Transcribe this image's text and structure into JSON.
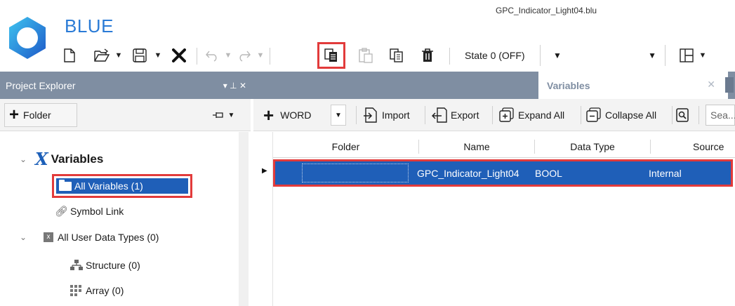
{
  "app": {
    "name": "BLUE",
    "file_title": "GPC_Indicator_Light04.blu"
  },
  "toolbar": {
    "icons": [
      "new-file-icon",
      "open-icon",
      "save-icon",
      "delete-x-icon",
      "undo-icon",
      "redo-icon",
      "copy-icon",
      "paste-icon",
      "duplicate-icon",
      "trash-icon",
      "layout-icon"
    ],
    "state_value": "State 0 (OFF)",
    "second_combo_value": ""
  },
  "project_explorer": {
    "title": "Project Explorer",
    "header_controls": "▾ ⊥ ✕",
    "folder_button": "Folder",
    "tree": {
      "root_label": "Variables",
      "all_variables": "All Variables (1)",
      "symbol_link": "Symbol Link",
      "user_data_types": "All User Data Types (0)",
      "structure": "Structure (0)",
      "array": "Array (0)"
    }
  },
  "document": {
    "tab_label": "Variables",
    "toolbar": {
      "word_label": "WORD",
      "import_label": "Import",
      "export_label": "Export",
      "expand_all_label": "Expand All",
      "collapse_all_label": "Collapse All",
      "search_placeholder": "Sea..."
    },
    "grid": {
      "columns": [
        "Folder",
        "Name",
        "Data Type",
        "Source"
      ],
      "rows": [
        {
          "folder": "",
          "name": "GPC_Indicator_Light04",
          "data_type": "BOOL",
          "source": "Internal"
        }
      ]
    }
  },
  "colors": {
    "accent_blue": "#1f5fb8",
    "header_gray": "#7f8ea2",
    "highlight_red": "#e23b3b",
    "brand_blue": "#2a7bd6"
  }
}
